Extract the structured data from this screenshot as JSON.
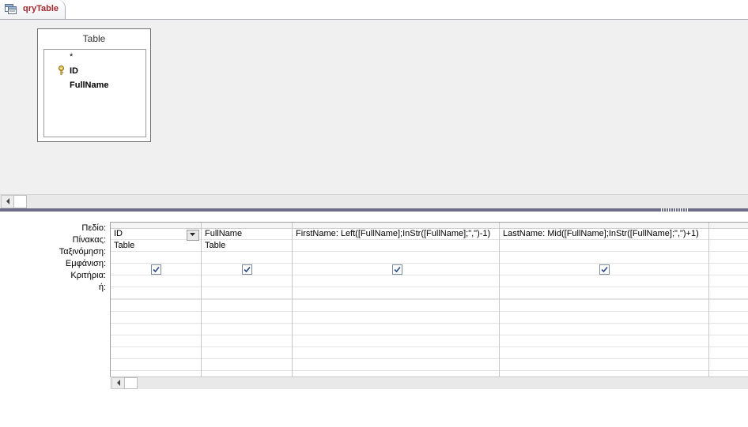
{
  "tab": {
    "label": "qryTable",
    "icon": "query-icon"
  },
  "table_box": {
    "title": "Table",
    "fields": [
      "*",
      "ID",
      "FullName"
    ],
    "primary_key_icon": "key-icon"
  },
  "grid": {
    "row_labels": [
      "Πεδίο:",
      "Πίνακας:",
      "Ταξινόμηση:",
      "Εμφάνιση:",
      "Κριτήρια:",
      "ή:"
    ],
    "columns": [
      {
        "field": "ID",
        "table": "Table",
        "sort": "",
        "show": true,
        "criteria": "",
        "or": ""
      },
      {
        "field": "FullName",
        "table": "Table",
        "sort": "",
        "show": true,
        "criteria": "",
        "or": ""
      },
      {
        "field": "FirstName: Left([FullName];InStr([FullName];\",\")-1)",
        "table": "",
        "sort": "",
        "show": true,
        "criteria": "",
        "or": ""
      },
      {
        "field": "LastName: Mid([FullName];InStr([FullName];\",\")+1)",
        "table": "",
        "sort": "",
        "show": true,
        "criteria": "",
        "or": ""
      }
    ]
  },
  "colors": {
    "tab_text": "#a1282e",
    "surface": "#f0f0f0",
    "splitter": "#6d6d8a"
  }
}
